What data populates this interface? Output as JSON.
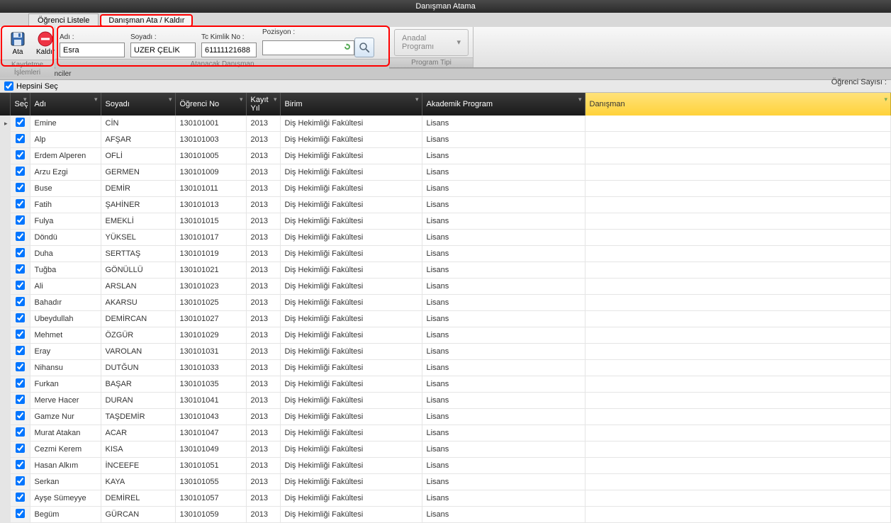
{
  "window": {
    "title": "Danışman Atama"
  },
  "tabs": [
    {
      "label": "Öğrenci Listele",
      "active": false
    },
    {
      "label": "Danışman Ata / Kaldır",
      "active": true
    }
  ],
  "ribbon": {
    "save_group_label": "Kaydetme İşlemleri",
    "assign_group_label": "Atanacak Danışman",
    "program_group_label": "Program Tipi",
    "ata_label": "Ata",
    "kaldir_label": "Kaldır",
    "adi_label": "Adı :",
    "soyadi_label": "Soyadı :",
    "tc_label": "Tc Kimlik No :",
    "pozisyon_label": "Pozisyon :",
    "adi_value": "Esra",
    "soyadi_value": "UZER ÇELİK",
    "tc_value": "61111121688",
    "pozisyon_value": "",
    "anadal_label": "Anadal Programı"
  },
  "list_header": "Listelenen Öğrenciler",
  "select_all_label": "Hepsini Seç",
  "count_label": "Öğrenci Sayısı :",
  "count_value": "",
  "columns": {
    "sec": "Seç",
    "adi": "Adı",
    "soyadi": "Soyadı",
    "ogrno": "Öğrenci No",
    "kayityil": "Kayıt Yıl",
    "birim": "Birim",
    "program": "Akademik Program",
    "danisman": "Danışman"
  },
  "rows": [
    {
      "adi": "Emine",
      "soyadi": "CİN",
      "no": "130101001",
      "yil": "2013",
      "birim": "Diş Hekimliği Fakültesi",
      "prog": "Lisans",
      "dan": ""
    },
    {
      "adi": "Alp",
      "soyadi": "AFŞAR",
      "no": "130101003",
      "yil": "2013",
      "birim": "Diş Hekimliği Fakültesi",
      "prog": "Lisans",
      "dan": ""
    },
    {
      "adi": "Erdem Alperen",
      "soyadi": "OFLİ",
      "no": "130101005",
      "yil": "2013",
      "birim": "Diş Hekimliği Fakültesi",
      "prog": "Lisans",
      "dan": ""
    },
    {
      "adi": "Arzu Ezgi",
      "soyadi": "GERMEN",
      "no": "130101009",
      "yil": "2013",
      "birim": "Diş Hekimliği Fakültesi",
      "prog": "Lisans",
      "dan": ""
    },
    {
      "adi": "Buse",
      "soyadi": "DEMİR",
      "no": "130101011",
      "yil": "2013",
      "birim": "Diş Hekimliği Fakültesi",
      "prog": "Lisans",
      "dan": ""
    },
    {
      "adi": "Fatih",
      "soyadi": "ŞAHİNER",
      "no": "130101013",
      "yil": "2013",
      "birim": "Diş Hekimliği Fakültesi",
      "prog": "Lisans",
      "dan": ""
    },
    {
      "adi": "Fulya",
      "soyadi": "EMEKLİ",
      "no": "130101015",
      "yil": "2013",
      "birim": "Diş Hekimliği Fakültesi",
      "prog": "Lisans",
      "dan": ""
    },
    {
      "adi": "Döndü",
      "soyadi": "YÜKSEL",
      "no": "130101017",
      "yil": "2013",
      "birim": "Diş Hekimliği Fakültesi",
      "prog": "Lisans",
      "dan": ""
    },
    {
      "adi": "Duha",
      "soyadi": "SERTTAŞ",
      "no": "130101019",
      "yil": "2013",
      "birim": "Diş Hekimliği Fakültesi",
      "prog": "Lisans",
      "dan": ""
    },
    {
      "adi": "Tuğba",
      "soyadi": "GÖNÜLLÜ",
      "no": "130101021",
      "yil": "2013",
      "birim": "Diş Hekimliği Fakültesi",
      "prog": "Lisans",
      "dan": ""
    },
    {
      "adi": "Ali",
      "soyadi": "ARSLAN",
      "no": "130101023",
      "yil": "2013",
      "birim": "Diş Hekimliği Fakültesi",
      "prog": "Lisans",
      "dan": ""
    },
    {
      "adi": "Bahadır",
      "soyadi": "AKARSU",
      "no": "130101025",
      "yil": "2013",
      "birim": "Diş Hekimliği Fakültesi",
      "prog": "Lisans",
      "dan": ""
    },
    {
      "adi": "Ubeydullah",
      "soyadi": "DEMİRCAN",
      "no": "130101027",
      "yil": "2013",
      "birim": "Diş Hekimliği Fakültesi",
      "prog": "Lisans",
      "dan": ""
    },
    {
      "adi": "Mehmet",
      "soyadi": "ÖZGÜR",
      "no": "130101029",
      "yil": "2013",
      "birim": "Diş Hekimliği Fakültesi",
      "prog": "Lisans",
      "dan": ""
    },
    {
      "adi": "Eray",
      "soyadi": "VAROLAN",
      "no": "130101031",
      "yil": "2013",
      "birim": "Diş Hekimliği Fakültesi",
      "prog": "Lisans",
      "dan": ""
    },
    {
      "adi": "Nihansu",
      "soyadi": "DUTĞUN",
      "no": "130101033",
      "yil": "2013",
      "birim": "Diş Hekimliği Fakültesi",
      "prog": "Lisans",
      "dan": ""
    },
    {
      "adi": "Furkan",
      "soyadi": "BAŞAR",
      "no": "130101035",
      "yil": "2013",
      "birim": "Diş Hekimliği Fakültesi",
      "prog": "Lisans",
      "dan": ""
    },
    {
      "adi": "Merve Hacer",
      "soyadi": "DURAN",
      "no": "130101041",
      "yil": "2013",
      "birim": "Diş Hekimliği Fakültesi",
      "prog": "Lisans",
      "dan": ""
    },
    {
      "adi": "Gamze Nur",
      "soyadi": "TAŞDEMİR",
      "no": "130101043",
      "yil": "2013",
      "birim": "Diş Hekimliği Fakültesi",
      "prog": "Lisans",
      "dan": ""
    },
    {
      "adi": "Murat Atakan",
      "soyadi": "ACAR",
      "no": "130101047",
      "yil": "2013",
      "birim": "Diş Hekimliği Fakültesi",
      "prog": "Lisans",
      "dan": ""
    },
    {
      "adi": "Cezmi Kerem",
      "soyadi": "KISA",
      "no": "130101049",
      "yil": "2013",
      "birim": "Diş Hekimliği Fakültesi",
      "prog": "Lisans",
      "dan": ""
    },
    {
      "adi": "Hasan Alkım",
      "soyadi": "İNCEEFE",
      "no": "130101051",
      "yil": "2013",
      "birim": "Diş Hekimliği Fakültesi",
      "prog": "Lisans",
      "dan": ""
    },
    {
      "adi": "Serkan",
      "soyadi": "KAYA",
      "no": "130101055",
      "yil": "2013",
      "birim": "Diş Hekimliği Fakültesi",
      "prog": "Lisans",
      "dan": ""
    },
    {
      "adi": "Ayşe Sümeyye",
      "soyadi": "DEMİREL",
      "no": "130101057",
      "yil": "2013",
      "birim": "Diş Hekimliği Fakültesi",
      "prog": "Lisans",
      "dan": ""
    },
    {
      "adi": "Begüm",
      "soyadi": "GÜRCAN",
      "no": "130101059",
      "yil": "2013",
      "birim": "Diş Hekimliği Fakültesi",
      "prog": "Lisans",
      "dan": ""
    }
  ]
}
